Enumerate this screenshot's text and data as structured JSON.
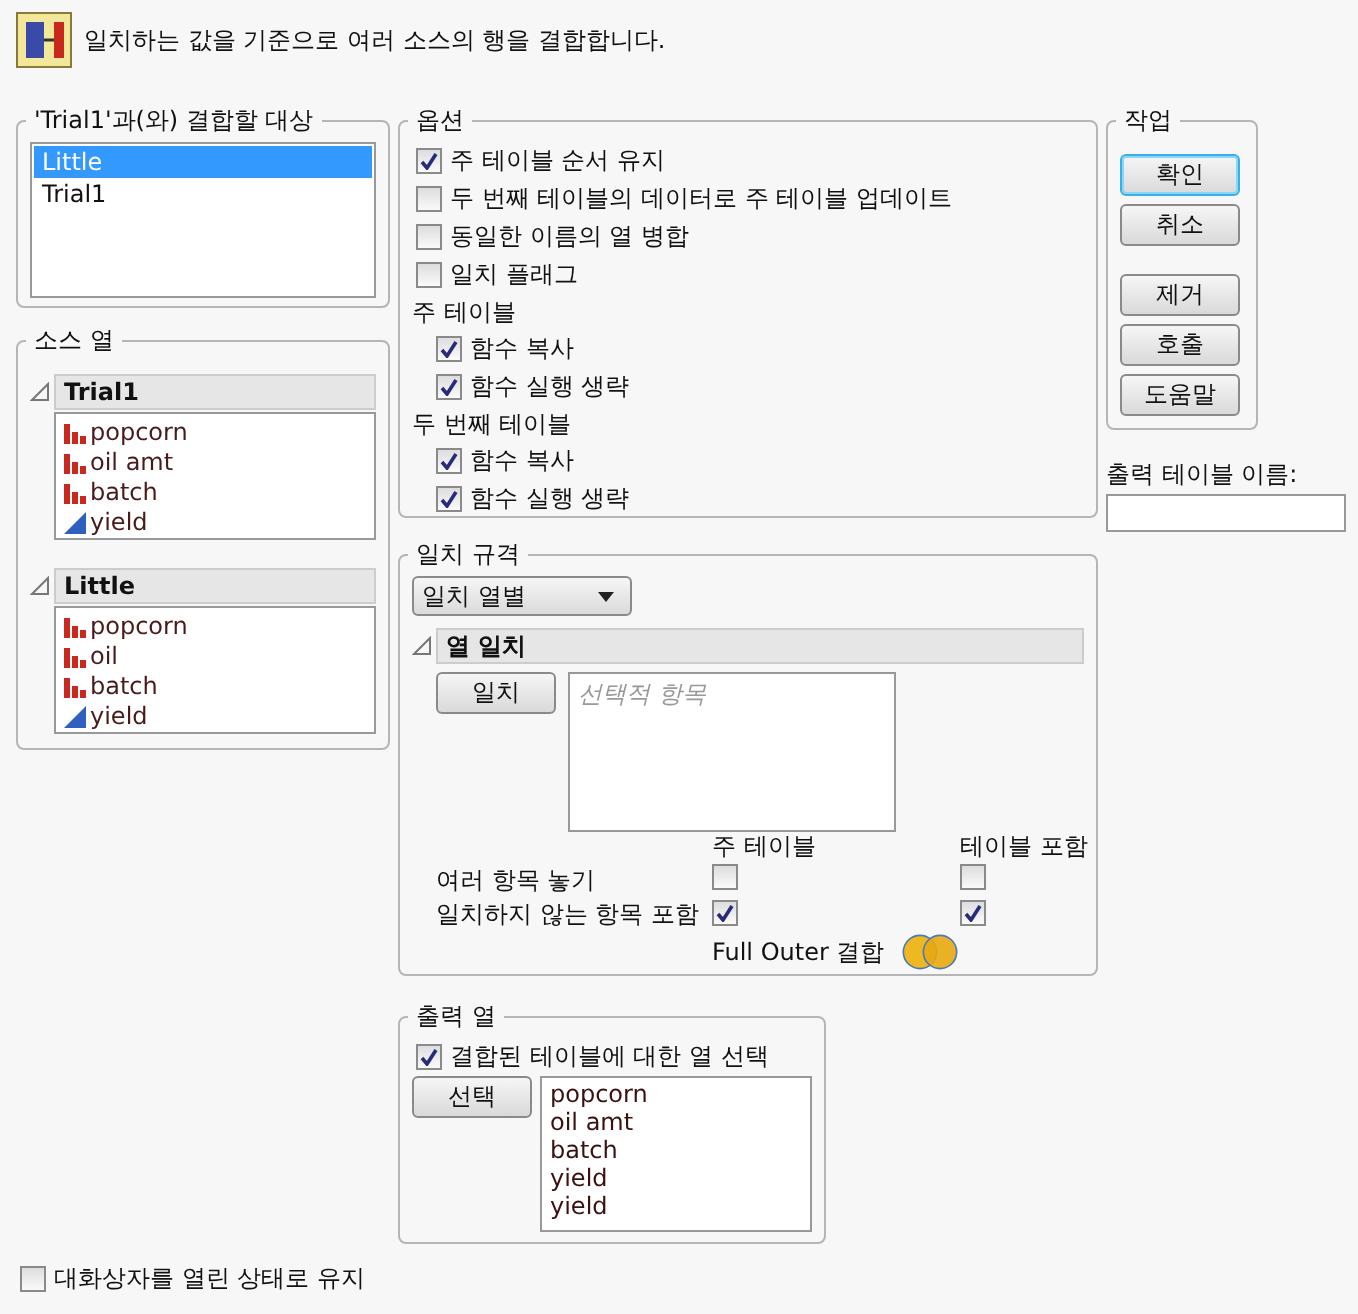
{
  "header": {
    "text": "일치하는 값을 기준으로 여러 소스의 행을 결합합니다."
  },
  "join_with": {
    "title": "'Trial1'과(와) 결합할 대상",
    "items": [
      {
        "label": "Little",
        "selected": true
      },
      {
        "label": "Trial1",
        "selected": false
      }
    ]
  },
  "source_columns": {
    "title": "소스 열",
    "tables": [
      {
        "name": "Trial1",
        "columns": [
          {
            "name": "popcorn",
            "kind": "nominal"
          },
          {
            "name": "oil amt",
            "kind": "nominal"
          },
          {
            "name": "batch",
            "kind": "nominal"
          },
          {
            "name": "yield",
            "kind": "continuous"
          }
        ]
      },
      {
        "name": "Little",
        "columns": [
          {
            "name": "popcorn",
            "kind": "nominal"
          },
          {
            "name": "oil",
            "kind": "nominal"
          },
          {
            "name": "batch",
            "kind": "nominal"
          },
          {
            "name": "yield",
            "kind": "continuous"
          }
        ]
      }
    ]
  },
  "options": {
    "title": "옵션",
    "items": [
      {
        "kind": "check",
        "label": "주 테이블 순서 유지",
        "checked": true
      },
      {
        "kind": "check",
        "label": "두 번째 테이블의 데이터로 주 테이블 업데이트",
        "checked": false
      },
      {
        "kind": "check",
        "label": "동일한 이름의 열 병합",
        "checked": false
      },
      {
        "kind": "check",
        "label": "일치 플래그",
        "checked": false
      },
      {
        "kind": "heading",
        "label": "주 테이블"
      },
      {
        "kind": "subcheck",
        "label": "함수 복사",
        "checked": true
      },
      {
        "kind": "subcheck",
        "label": "함수 실행 생략",
        "checked": true
      },
      {
        "kind": "heading",
        "label": "두 번째 테이블"
      },
      {
        "kind": "subcheck",
        "label": "함수 복사",
        "checked": true
      },
      {
        "kind": "subcheck",
        "label": "함수 실행 생략",
        "checked": true
      }
    ]
  },
  "matching": {
    "title": "일치 규격",
    "method": "일치 열별",
    "section": "열 일치",
    "match_button": "일치",
    "list_placeholder": "선택적 항목",
    "col_headers": [
      "주 테이블",
      "테이블 포함"
    ],
    "rows": [
      {
        "label": "여러 항목 놓기",
        "main": false,
        "with": false
      },
      {
        "label": "일치하지 않는 항목 포함",
        "main": true,
        "with": true
      }
    ],
    "join_label": "Full Outer 결합"
  },
  "output_columns": {
    "title": "출력 열",
    "select_checkbox": {
      "label": "결합된 테이블에 대한 열 선택",
      "checked": true
    },
    "select_button": "선택",
    "items": [
      "popcorn",
      "oil amt",
      "batch",
      "yield",
      "yield"
    ]
  },
  "actions": {
    "title": "작업",
    "groups": [
      [
        {
          "label": "확인",
          "focused": true
        },
        {
          "label": "취소",
          "focused": false
        }
      ],
      [
        {
          "label": "제거",
          "focused": false
        },
        {
          "label": "호출",
          "focused": false
        },
        {
          "label": "도움말",
          "focused": false
        }
      ]
    ]
  },
  "output_name": {
    "label": "출력 테이블 이름:"
  },
  "keep_open": {
    "label": "대화상자를 열린 상태로 유지",
    "checked": false
  }
}
